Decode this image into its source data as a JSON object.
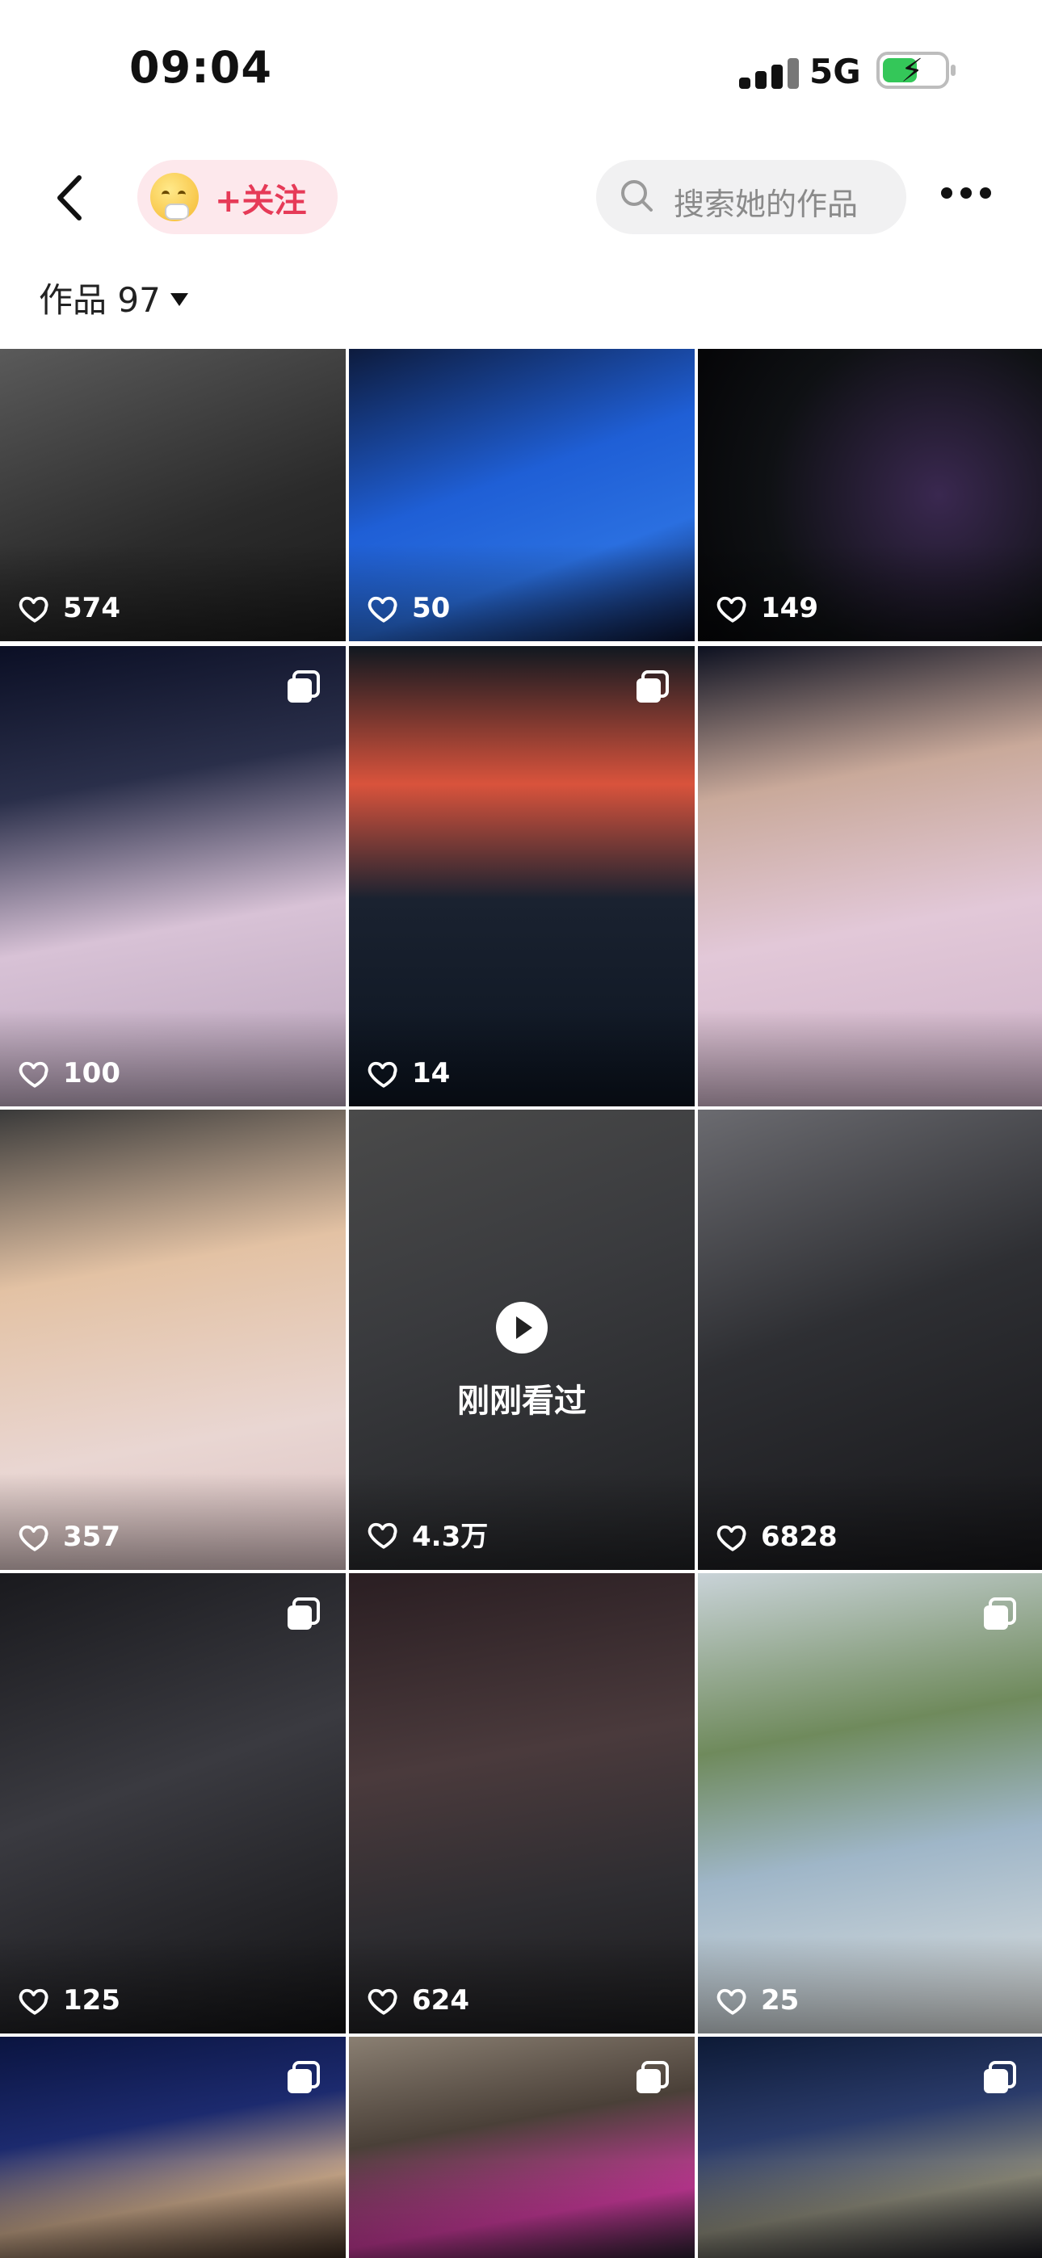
{
  "status_bar": {
    "time": "09:04",
    "network": "5G"
  },
  "header": {
    "follow_label": "+关注",
    "search_placeholder": "搜索她的作品"
  },
  "works": {
    "label": "作品 97"
  },
  "grid": {
    "cells": [
      {
        "likes": "574",
        "multi": false,
        "bg": "linear-gradient(160deg,#5a5a5a 0%,#2b2b2b 60%,#1a1a1a 100%)"
      },
      {
        "likes": "50",
        "multi": false,
        "bg": "linear-gradient(160deg,#0d1b3d 0%,#1f5fd6 45%,#2a6fe0 70%,#0a1230 100%)"
      },
      {
        "likes": "149",
        "multi": false,
        "bg": "radial-gradient(circle at 70% 50%,#3a2850 0%,#0f1114 60%,#050507 100%)"
      },
      {
        "likes": "100",
        "multi": true,
        "bg": "linear-gradient(170deg,#0b0f25 0%,#2a2f4a 30%,#d8c2d6 60%,#b9a4bb 100%)"
      },
      {
        "likes": "14",
        "multi": true,
        "bg": "linear-gradient(180deg,#101820 0%,#d9533c 30%,#1a2230 55%,#0c1420 100%)"
      },
      {
        "likes": "",
        "multi": false,
        "bg": "linear-gradient(170deg,#0c1020 0%,#c9a99a 30%,#e2c8d8 60%,#cdb2c8 100%)"
      },
      {
        "likes": "357",
        "multi": false,
        "bg": "linear-gradient(170deg,#3a3a3a 0%,#e3c2a4 35%,#e9d6d2 70%,#d9c0c2 100%)"
      },
      {
        "likes": "4.3万",
        "multi": false,
        "bg": "linear-gradient(160deg,#4a4a4a 0%,#3a3b3e 40%,#202124 100%)"
      },
      {
        "likes": "6828",
        "multi": false,
        "bg": "linear-gradient(160deg,#6b6b70 0%,#2e2f33 45%,#161619 100%)"
      },
      {
        "likes": "125",
        "multi": true,
        "bg": "linear-gradient(160deg,#1a1a1e 0%,#3a3a40 45%,#121214 100%)"
      },
      {
        "likes": "624",
        "multi": false,
        "bg": "linear-gradient(170deg,#2a1e22 0%,#4a3a3c 40%,#2e2d31 70%,#1a1a1c 100%)"
      },
      {
        "likes": "25",
        "multi": true,
        "bg": "linear-gradient(170deg,#c9d3d8 0%,#6f8a5c 35%,#9fb6c8 60%,#e0e2e0 100%)"
      },
      {
        "likes": "",
        "multi": true,
        "bg": "linear-gradient(170deg,#0a1440 0%,#1c2a6e 40%,#c9a88a 70%,#3a2a20 100%)"
      },
      {
        "likes": "",
        "multi": true,
        "bg": "linear-gradient(170deg,#8a7f72 0%,#4a4038 40%,#c83a9a 75%,#2a2030 100%)"
      },
      {
        "likes": "",
        "multi": true,
        "bg": "linear-gradient(170deg,#0d1a36 0%,#2a3b6a 40%,#8c8a7a 70%,#1a1a22 100%)"
      }
    ],
    "recent": {
      "index": 7,
      "label": "刚刚看过"
    }
  }
}
